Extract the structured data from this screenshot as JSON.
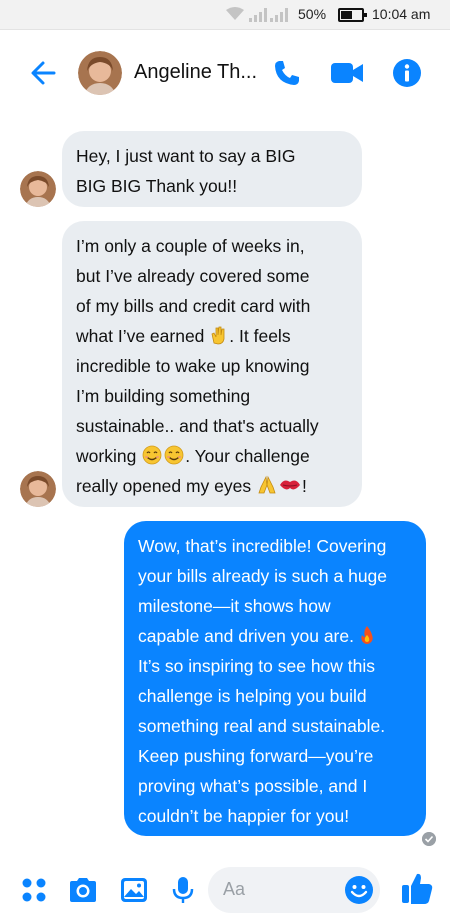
{
  "status_bar": {
    "battery": "50%",
    "time": "10:04 am"
  },
  "header": {
    "contact_name": "Angeline Th..."
  },
  "messages": {
    "m1_lines": [
      "Hey, I just want to say a BIG",
      "BIG BIG Thank you!!"
    ],
    "m2_lines": [
      "I’m only a couple of weeks in,",
      "but I’ve already covered some",
      "of my bills and credit card with",
      "what I’ve earned",
      ". It feels",
      "incredible to wake up knowing",
      "I’m building something",
      "sustainable.. and that's actually",
      "working",
      ". Your challenge",
      "really opened my eyes",
      "!"
    ],
    "m3_lines": [
      "Wow, that’s incredible! Covering",
      "your bills already is such a huge",
      "milestone—it shows how",
      "capable and driven you are.",
      "It’s so inspiring to see how this",
      "challenge is helping you build",
      "something real and sustainable.",
      "Keep pushing forward—you’re",
      "proving what’s possible, and I",
      "couldn’t be happier for you!"
    ]
  },
  "composer": {
    "placeholder": "Aa"
  },
  "colors": {
    "accent": "#0a84ff",
    "incoming_bubble": "#e9edf1"
  }
}
